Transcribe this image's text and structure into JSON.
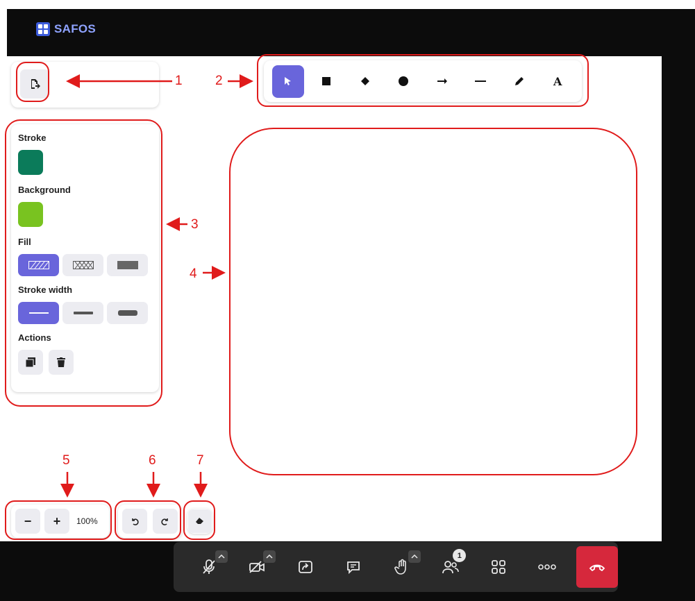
{
  "app": {
    "brand": "SAFOS"
  },
  "toolbar": {
    "tools": [
      {
        "name": "select",
        "icon": "pointer-icon",
        "active": true
      },
      {
        "name": "rectangle",
        "icon": "square-icon"
      },
      {
        "name": "diamond",
        "icon": "diamond-icon"
      },
      {
        "name": "ellipse",
        "icon": "circle-icon"
      },
      {
        "name": "arrow",
        "icon": "arrow-right-icon"
      },
      {
        "name": "line",
        "icon": "line-icon"
      },
      {
        "name": "draw",
        "icon": "pencil-icon"
      },
      {
        "name": "text",
        "icon": "text-icon",
        "label": "A"
      }
    ]
  },
  "properties": {
    "stroke_label": "Stroke",
    "stroke_color": "#0b7b5a",
    "background_label": "Background",
    "background_color": "#79c320",
    "fill_label": "Fill",
    "fill_options": [
      "hachure",
      "cross-hatch",
      "solid"
    ],
    "fill_selected": "hachure",
    "stroke_width_label": "Stroke width",
    "stroke_width_options": [
      "thin",
      "bold",
      "extra-bold"
    ],
    "stroke_width_selected": "thin",
    "actions_label": "Actions",
    "actions": [
      "duplicate-icon",
      "trash-icon"
    ]
  },
  "zoom": {
    "minus": "−",
    "plus": "+",
    "level": "100%"
  },
  "history": {
    "undo": "undo-icon",
    "redo": "redo-icon"
  },
  "eraser": {
    "icon": "eraser-icon"
  },
  "annotations": {
    "n1": "1",
    "n2": "2",
    "n3": "3",
    "n4": "4",
    "n5": "5",
    "n6": "6",
    "n7": "7",
    "color": "#e01b1b"
  },
  "call_controls": {
    "participants_count": "1",
    "hangup_color": "#d6283c"
  }
}
